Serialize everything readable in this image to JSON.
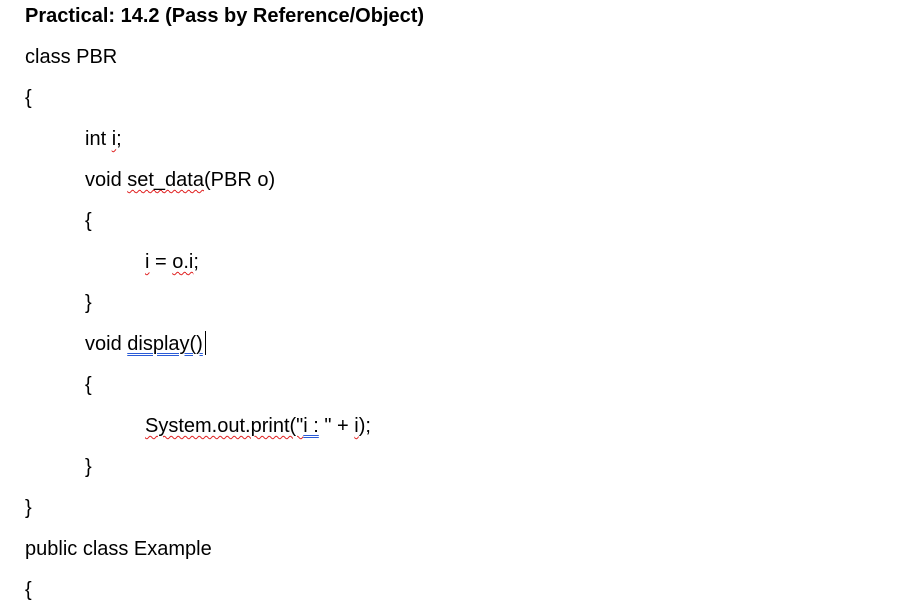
{
  "document": {
    "title": "Practical: 14.2 (Pass by Reference/Object)",
    "lines": [
      {
        "text": "class PBR"
      },
      {
        "text": "{"
      },
      {
        "pre": "int ",
        "mark": "i",
        "post": ";"
      },
      {
        "pre": "void ",
        "mark": "set_data",
        "post": "(PBR o)"
      },
      {
        "text": "{"
      },
      {
        "mark": "i",
        "mid": " = ",
        "mark2": "o.i",
        "post": ";"
      },
      {
        "text": "}"
      },
      {
        "pre": "void ",
        "mark": "display()",
        "post": ""
      },
      {
        "text": "{"
      },
      {
        "mark": "System.out.print(\"",
        "mark2": "i :",
        "post": " \" + ",
        "mark3": "i",
        "post2": ");"
      },
      {
        "text": "}"
      },
      {
        "text": "}"
      },
      {
        "text": "public class Example"
      },
      {
        "text": "{"
      }
    ]
  }
}
